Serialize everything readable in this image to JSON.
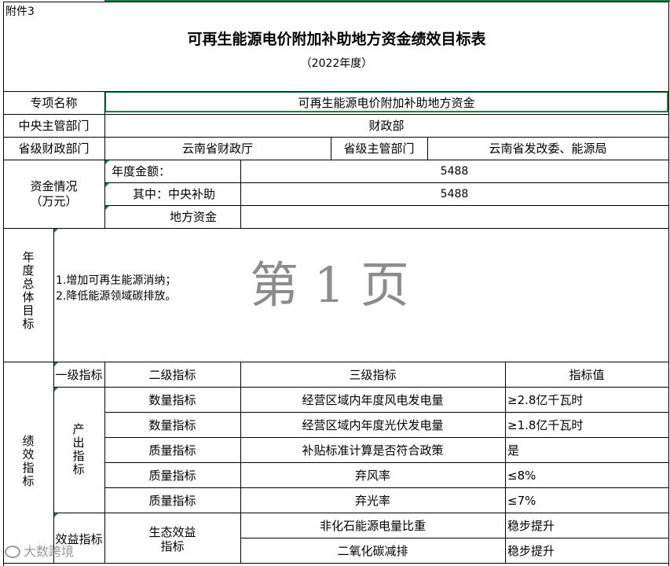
{
  "annex_label": "附件3",
  "title": "可再生能源电价附加补助地方资金绩效目标表",
  "year": "（2022年度）",
  "project_name_label": "专项名称",
  "project_name_value": "可再生能源电价附加补助地方资金",
  "central_dept_label": "中央主管部门",
  "central_dept_value": "财政部",
  "prov_finance_label": "省级财政部门",
  "prov_finance_value": "云南省财政厅",
  "prov_dept_label": "省级主管部门",
  "prov_dept_value": "云南省发改委、能源局",
  "funds_label": "资金情况（万元）",
  "funds_label_line1": "资金情况",
  "funds_label_line2": "（万元）",
  "annual_amount_label": "年度金额：",
  "annual_amount_value": "5488",
  "central_subsidy_label": "其中：中央补助",
  "central_subsidy_value": "5488",
  "local_funds_label": "地方资金",
  "local_funds_value": "",
  "goal_label": "年度总体目标",
  "goal_line1": "1.增加可再生能源消纳；",
  "goal_line2": "2.降低能源领域碳排放。",
  "page_watermark": "第 1 页",
  "perf_label": "绩效指标",
  "header_level1": "一级指标",
  "header_level2": "二级指标",
  "header_level3": "三级指标",
  "header_value": "指标值",
  "output_label": "产出指标",
  "benefit_label": "效益指标",
  "eco_benefit_line1": "生态效益",
  "eco_benefit_line2": "指标",
  "rows": [
    {
      "level2": "数量指标",
      "level3": "经营区域内年度风电发电量",
      "value": "≥2.8亿千瓦时"
    },
    {
      "level2": "数量指标",
      "level3": "经营区域内年度光伏发电量",
      "value": "≥1.8亿千瓦时"
    },
    {
      "level2": "质量指标",
      "level3": "补贴标准计算是否符合政策",
      "value": "是"
    },
    {
      "level2": "质量指标",
      "level3": "弃风率",
      "value": "≤8%"
    },
    {
      "level2": "质量指标",
      "level3": "弃光率",
      "value": "≤7%"
    },
    {
      "level2": "",
      "level3": "非化石能源电量比重",
      "value": "稳步提升"
    },
    {
      "level2": "",
      "level3": "二氧化碳减排",
      "value": "稳步提升"
    }
  ],
  "corner_watermark": "大数跨境",
  "colors": {
    "selection_border": "#1a7f4b",
    "grid": "#000000",
    "watermark": "#9a9a9a"
  }
}
